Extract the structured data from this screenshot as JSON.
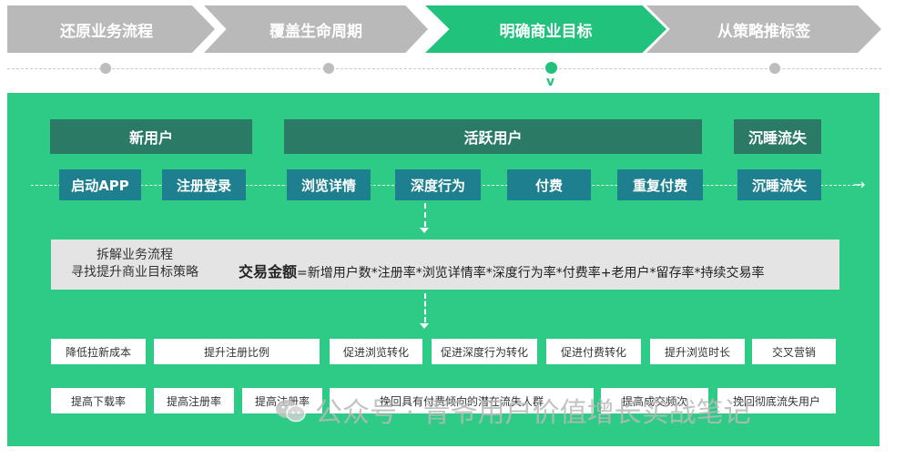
{
  "steps": [
    {
      "label": "还原业务流程",
      "state": "inactive"
    },
    {
      "label": "覆盖生命周期",
      "state": "inactive"
    },
    {
      "label": "明确商业目标",
      "state": "active"
    },
    {
      "label": "从策略推标签",
      "state": "inactive"
    }
  ],
  "step_marker": "v",
  "stages": [
    "新用户",
    "活跃用户",
    "沉睡流失"
  ],
  "events": [
    "启动APP",
    "注册登录",
    "浏览详情",
    "深度行为",
    "付费",
    "重复付费",
    "沉睡流失"
  ],
  "breakdown": {
    "line1": "拆解业务流程",
    "line2": "寻找提升商业目标策略",
    "formula_bold": "交易金额",
    "formula_rest": "=新增用户数*注册率*浏览详情率*深度行为率*付费率+老用户*留存率*持续交易率"
  },
  "strategies_row1": [
    "降低拉新成本",
    "提升注册比例",
    "促进浏览转化",
    "促进深度行为转化",
    "促进付费转化",
    "提升浏览时长",
    "交叉营销"
  ],
  "strategies_row2": [
    "提高下载率",
    "提高注册率",
    "提高注册率",
    "挽回具有付费倾向的潜在流失人群",
    "提高成交频次",
    "挽回彻底流失用户"
  ],
  "watermark": "公众号 · 青爷用户价值增长实战笔记",
  "colors": {
    "accent_green": "#21c27c",
    "panel_green": "#2dcb85",
    "stage_dark_green": "#2a7a66",
    "event_teal": "#1e7f8e",
    "step_gray": "#b9b9b9"
  }
}
